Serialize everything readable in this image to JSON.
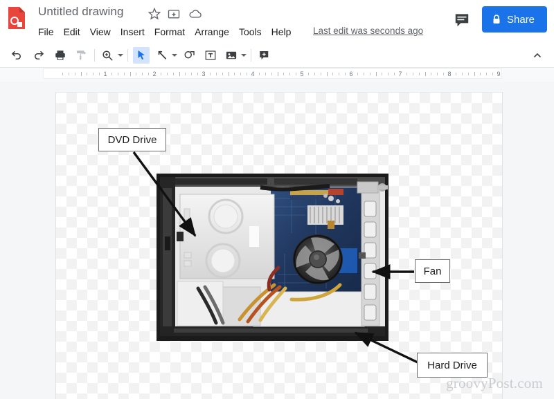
{
  "app": {
    "logo_icon": "google-drawings-logo",
    "title": "Untitled drawing",
    "title_icons": [
      {
        "name": "star-icon",
        "glyph": "star"
      },
      {
        "name": "move-to-folder-icon",
        "glyph": "folder-move"
      },
      {
        "name": "cloud-saved-icon",
        "glyph": "cloud"
      }
    ]
  },
  "menu": {
    "items": [
      {
        "label": "File"
      },
      {
        "label": "Edit"
      },
      {
        "label": "View"
      },
      {
        "label": "Insert"
      },
      {
        "label": "Format"
      },
      {
        "label": "Arrange"
      },
      {
        "label": "Tools"
      },
      {
        "label": "Help"
      }
    ],
    "last_edit": "Last edit was seconds ago"
  },
  "header_actions": {
    "comment_icon": "comment-icon",
    "share_label": "Share",
    "share_lock_icon": "lock-icon",
    "share_color": "#1a73e8"
  },
  "toolbar": {
    "items": [
      {
        "name": "undo-button",
        "icon": "undo-icon",
        "state": "enabled",
        "caret": false
      },
      {
        "name": "redo-button",
        "icon": "redo-icon",
        "state": "enabled",
        "caret": false
      },
      {
        "name": "print-button",
        "icon": "print-icon",
        "state": "enabled",
        "caret": false
      },
      {
        "name": "paint-format-button",
        "icon": "paint-roller-icon",
        "state": "disabled",
        "caret": false
      },
      {
        "name": "zoom-button",
        "icon": "magnifier-icon",
        "state": "enabled",
        "caret": true
      },
      {
        "name": "select-tool-button",
        "icon": "cursor-arrow-icon",
        "state": "active",
        "caret": false
      },
      {
        "name": "line-tool-button",
        "icon": "line-icon",
        "state": "enabled",
        "caret": true
      },
      {
        "name": "shape-tool-button",
        "icon": "shape-icon",
        "state": "enabled",
        "caret": false
      },
      {
        "name": "text-box-button",
        "icon": "text-box-icon",
        "state": "enabled",
        "caret": false
      },
      {
        "name": "image-button",
        "icon": "image-icon",
        "state": "enabled",
        "caret": true
      },
      {
        "name": "comment-add-button",
        "icon": "add-comment-icon",
        "state": "enabled",
        "caret": false
      }
    ],
    "collapse_icon": "chevron-up-icon"
  },
  "ruler": {
    "marks": [
      "1",
      "2",
      "3",
      "4",
      "5",
      "6",
      "7",
      "8",
      "9"
    ]
  },
  "canvas": {
    "background": "transparency-checkerboard",
    "image_name": "computer-case-interior-photo",
    "callouts": [
      {
        "name": "callout-dvd-drive",
        "label": "DVD Drive",
        "arrow": "diagonal-down-right"
      },
      {
        "name": "callout-fan",
        "label": "Fan",
        "arrow": "horizontal-left"
      },
      {
        "name": "callout-hard-drive",
        "label": "Hard Drive",
        "arrow": "diagonal-up-left"
      }
    ]
  },
  "watermark": {
    "text": "groovyPost.com"
  }
}
